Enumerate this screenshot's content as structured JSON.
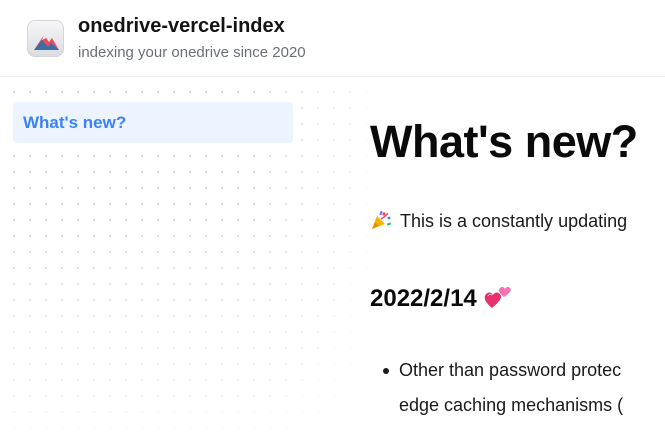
{
  "header": {
    "title": "onedrive-vercel-index",
    "subtitle": "indexing your onedrive since 2020",
    "logo_icon": "mountain-logo-icon"
  },
  "sidebar": {
    "items": [
      {
        "label": "What's new?",
        "active": true
      }
    ]
  },
  "main": {
    "title": "What's new?",
    "intro": "This is a constantly updating",
    "intro_icon": "party-popper-icon",
    "section": {
      "heading": "2022/2/14",
      "heading_icon": "revolving-hearts-icon",
      "bullets": [
        {
          "line1": "Other than password protec",
          "line2": "edge caching mechanisms ("
        }
      ]
    }
  },
  "colors": {
    "accent": "#3b82f6",
    "active_bg": "#eef4ff",
    "subtitle": "#6b6f76"
  }
}
